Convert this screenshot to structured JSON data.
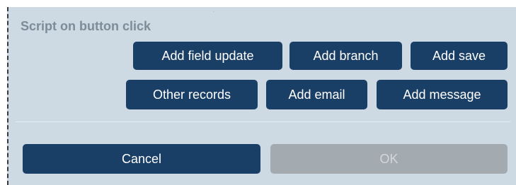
{
  "section": {
    "title": "Script on button click"
  },
  "actions": {
    "add_field_update": "Add field update",
    "add_branch": "Add branch",
    "add_save": "Add save",
    "other_records": "Other records",
    "add_email": "Add email",
    "add_message": "Add message"
  },
  "footer": {
    "cancel": "Cancel",
    "ok": "OK"
  },
  "colors": {
    "panel_bg": "#cdd9e3",
    "primary_button": "#1a3f66",
    "disabled_button": "#a3abb1",
    "title_text": "#7c8c98"
  }
}
